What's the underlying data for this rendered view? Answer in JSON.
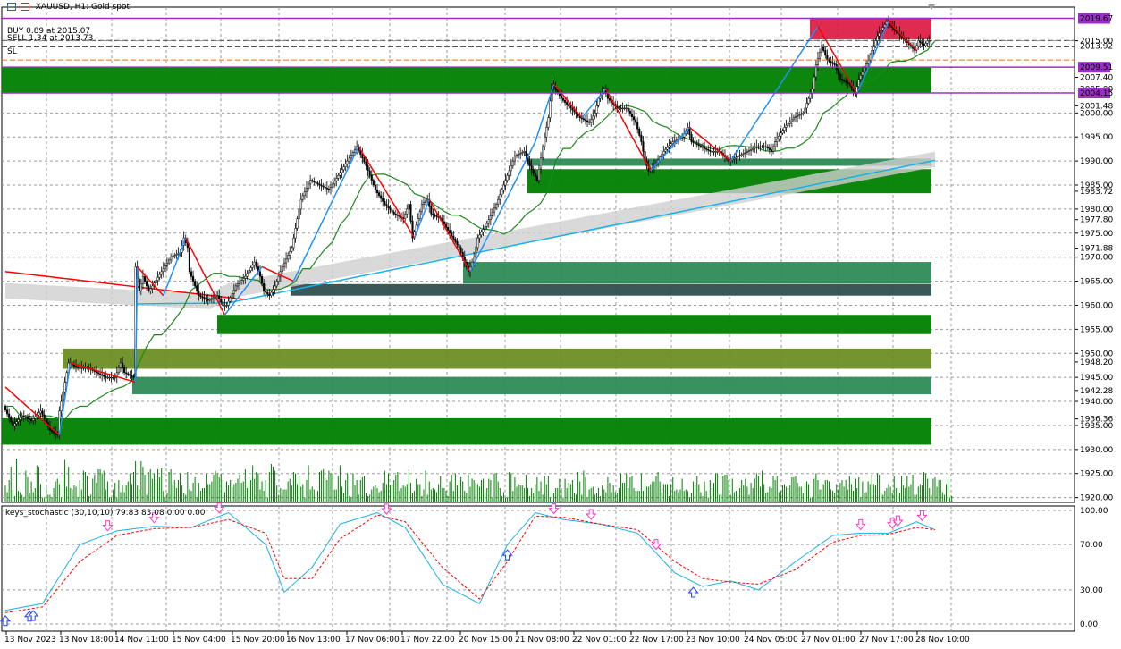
{
  "window": {
    "title": "XAUUSD, H1:  Gold spot",
    "trade_buy": "BUY 0.89 at 2015.07",
    "trade_sell": "SELL 1.34 at 2013.73",
    "trade_sl": "SL"
  },
  "indicator": {
    "label": "keys_stochastic (30,10,10) 79.83 83.08 0.00 0.00"
  },
  "colors": {
    "background": "#ffffff",
    "grid": "#9a9a9a",
    "bull_candle": "#000000",
    "level_purple": "#9b30c8",
    "zone_green": "#008000",
    "zone_olive": "#6b8e23",
    "zone_teal": "#2e8b57",
    "zone_dark": "#2f4f4f",
    "zone_red": "#dc143c",
    "ma_red": "#ff0000",
    "ma_green": "#1b8a1b",
    "ma_blue": "#1ab2e8",
    "zigzag_up": "#1e90ff",
    "zigzag_down": "#ff0000",
    "volume": "#008000",
    "stoch_main": "#1ab2e8",
    "stoch_signal": "#ff0000",
    "arrow_up": "#1e3cff",
    "arrow_down": "#ff33cc"
  },
  "chart_data": {
    "type": "candlestick",
    "symbol": "XAUUSD",
    "timeframe": "H1",
    "price_axis": {
      "ticks": [
        2019.67,
        2015.0,
        2013.92,
        2009.51,
        2007.4,
        2005.0,
        2004.15,
        2001.48,
        2000.0,
        1995.0,
        1990.0,
        1985.0,
        1983.72,
        1980.0,
        1977.8,
        1975.0,
        1971.88,
        1970.0,
        1965.0,
        1960.0,
        1955.0,
        1950.0,
        1948.2,
        1945.0,
        1942.28,
        1940.0,
        1936.36,
        1935.0,
        1930.0,
        1925.0,
        1920.0
      ],
      "range": [
        1919,
        2022
      ],
      "highlighted": [
        {
          "value": "2019.67",
          "bg": "#9b30c8"
        },
        {
          "value": "2009.51",
          "bg": "#9b30c8"
        },
        {
          "value": "2004.15",
          "bg": "#9b30c8"
        }
      ]
    },
    "time_axis": [
      "13 Nov 2023",
      "13 Nov 18:00",
      "14 Nov 11:00",
      "15 Nov 04:00",
      "15 Nov 20:00",
      "16 Nov 13:00",
      "17 Nov 06:00",
      "17 Nov 22:00",
      "20 Nov 15:00",
      "21 Nov 08:00",
      "22 Nov 01:00",
      "22 Nov 17:00",
      "23 Nov 10:00",
      "24 Nov 05:00",
      "27 Nov 01:00",
      "27 Nov 17:00",
      "28 Nov 10:00"
    ],
    "price_path": [
      [
        0,
        1939
      ],
      [
        5,
        1935
      ],
      [
        10,
        1937
      ],
      [
        15,
        1936
      ],
      [
        20,
        1938
      ],
      [
        25,
        1934
      ],
      [
        29,
        1933
      ],
      [
        30,
        1938
      ],
      [
        33,
        1944
      ],
      [
        35,
        1948
      ],
      [
        40,
        1947
      ],
      [
        45,
        1947
      ],
      [
        50,
        1946
      ],
      [
        55,
        1945
      ],
      [
        60,
        1945
      ],
      [
        63,
        1948
      ],
      [
        65,
        1946
      ],
      [
        70,
        1945
      ],
      [
        71,
        1968
      ],
      [
        73,
        1963
      ],
      [
        75,
        1966
      ],
      [
        78,
        1963
      ],
      [
        80,
        1964
      ],
      [
        85,
        1967
      ],
      [
        90,
        1970
      ],
      [
        95,
        1971
      ],
      [
        97,
        1974
      ],
      [
        99,
        1972
      ],
      [
        100,
        1967
      ],
      [
        105,
        1962
      ],
      [
        110,
        1961
      ],
      [
        115,
        1962
      ],
      [
        118,
        1960
      ],
      [
        120,
        1960
      ],
      [
        125,
        1964
      ],
      [
        130,
        1966
      ],
      [
        135,
        1969
      ],
      [
        138,
        1966
      ],
      [
        140,
        1963
      ],
      [
        143,
        1962
      ],
      [
        146,
        1964
      ],
      [
        150,
        1968
      ],
      [
        155,
        1972
      ],
      [
        160,
        1982
      ],
      [
        165,
        1986
      ],
      [
        170,
        1985
      ],
      [
        175,
        1984
      ],
      [
        180,
        1987
      ],
      [
        185,
        1990
      ],
      [
        190,
        1993
      ],
      [
        195,
        1989
      ],
      [
        200,
        1984
      ],
      [
        205,
        1981
      ],
      [
        210,
        1979
      ],
      [
        215,
        1978
      ],
      [
        218,
        1981
      ],
      [
        220,
        1974
      ],
      [
        223,
        1978
      ],
      [
        225,
        1981
      ],
      [
        228,
        1982
      ],
      [
        230,
        1979
      ],
      [
        235,
        1978
      ],
      [
        240,
        1975
      ],
      [
        245,
        1972
      ],
      [
        250,
        1967
      ],
      [
        253,
        1970
      ],
      [
        255,
        1974
      ],
      [
        260,
        1977
      ],
      [
        265,
        1981
      ],
      [
        270,
        1986
      ],
      [
        275,
        1991
      ],
      [
        280,
        1992
      ],
      [
        283,
        1989
      ],
      [
        287,
        1986
      ],
      [
        290,
        1993
      ],
      [
        293,
        1999
      ],
      [
        295,
        2006
      ],
      [
        300,
        2003
      ],
      [
        305,
        2001
      ],
      [
        310,
        1999
      ],
      [
        315,
        1998
      ],
      [
        318,
        2000
      ],
      [
        320,
        2003
      ],
      [
        323,
        2005
      ],
      [
        325,
        2003
      ],
      [
        330,
        2001
      ],
      [
        335,
        2001
      ],
      [
        340,
        1998
      ],
      [
        343,
        1994
      ],
      [
        345,
        1990
      ],
      [
        347,
        1988
      ],
      [
        350,
        1989
      ],
      [
        355,
        1992
      ],
      [
        360,
        1994
      ],
      [
        365,
        1995
      ],
      [
        368,
        1997
      ],
      [
        370,
        1994
      ],
      [
        375,
        1993
      ],
      [
        380,
        1992
      ],
      [
        385,
        1992
      ],
      [
        390,
        1990
      ],
      [
        395,
        1991
      ],
      [
        400,
        1992
      ],
      [
        405,
        1993
      ],
      [
        410,
        1993
      ],
      [
        413,
        1992
      ],
      [
        415,
        1994
      ],
      [
        420,
        1997
      ],
      [
        425,
        1999
      ],
      [
        430,
        2000
      ],
      [
        433,
        2003
      ],
      [
        435,
        2005
      ],
      [
        437,
        2010
      ],
      [
        440,
        2014
      ],
      [
        443,
        2011
      ],
      [
        447,
        2010
      ],
      [
        450,
        2007
      ],
      [
        455,
        2006
      ],
      [
        458,
        2004
      ],
      [
        460,
        2007
      ],
      [
        465,
        2011
      ],
      [
        470,
        2016
      ],
      [
        475,
        2019
      ],
      [
        480,
        2017
      ],
      [
        485,
        2015
      ],
      [
        490,
        2013
      ],
      [
        492,
        2015
      ],
      [
        495,
        2014
      ],
      [
        497,
        2015
      ]
    ],
    "volume": [
      12,
      7,
      16,
      26,
      9,
      4,
      32,
      8,
      7,
      5,
      3,
      23,
      18,
      6,
      15,
      7,
      10,
      27,
      26,
      13,
      3,
      3,
      11,
      5,
      5,
      3,
      10,
      15,
      17,
      13,
      3,
      20,
      31,
      11,
      26,
      10,
      9,
      12,
      11,
      3,
      16,
      9,
      23,
      22,
      19,
      4,
      5,
      17,
      20,
      14,
      24,
      24,
      21,
      23,
      9,
      15,
      3,
      3,
      9,
      14,
      3,
      16,
      7,
      12,
      7,
      12,
      15,
      21,
      13,
      22,
      30,
      12,
      9,
      30,
      26,
      20,
      5,
      22,
      24,
      17,
      21,
      14,
      24,
      18,
      25,
      8,
      3,
      6,
      22,
      24,
      13,
      16,
      10,
      16,
      21,
      12,
      6,
      5,
      22,
      9,
      8,
      14,
      18,
      3,
      14,
      8,
      10,
      10,
      21,
      13,
      13,
      15,
      20,
      23,
      21,
      18,
      21,
      16,
      7,
      15,
      12,
      16,
      11,
      13,
      14,
      17,
      20,
      14,
      15,
      24,
      10,
      18,
      16,
      27,
      17,
      22,
      21,
      9,
      15,
      8,
      16,
      3,
      22,
      28,
      26,
      23,
      12,
      5,
      10,
      9,
      9,
      9,
      15,
      17,
      12,
      22,
      21,
      13,
      19,
      11,
      13,
      3,
      16,
      27,
      9,
      11,
      9,
      3,
      8,
      22,
      23,
      24,
      17,
      16,
      23,
      21,
      21,
      9,
      9,
      19,
      27,
      11,
      6,
      16,
      21,
      4,
      3,
      21,
      12,
      16,
      5,
      16,
      18,
      19,
      6,
      4,
      5,
      9,
      11,
      12,
      10,
      7,
      8,
      14,
      23,
      13,
      21,
      12,
      12,
      16,
      20,
      22,
      8,
      10,
      12,
      11,
      13,
      24,
      14,
      6,
      8,
      17,
      13,
      13,
      4,
      9,
      23,
      5,
      15,
      9,
      10,
      9,
      7,
      13,
      19,
      10,
      10,
      8,
      4,
      15,
      20,
      8,
      21,
      12,
      16,
      18,
      15,
      8,
      6,
      20,
      11,
      17,
      16,
      14,
      13,
      11,
      16,
      17,
      7,
      10,
      17,
      16,
      3,
      21,
      21,
      15,
      10,
      4,
      7,
      3,
      3,
      22,
      21,
      8,
      18,
      11,
      13,
      12,
      12,
      10,
      20,
      10,
      4,
      10,
      6,
      13,
      18,
      8,
      15,
      5,
      19,
      13,
      19,
      3,
      8,
      6,
      10,
      10,
      17,
      10,
      3,
      17,
      10,
      14,
      13,
      16,
      6,
      5,
      22,
      15,
      5,
      23,
      18,
      3,
      9,
      10,
      11,
      5,
      6,
      10,
      4,
      12,
      9,
      7,
      18,
      14,
      7,
      12,
      7,
      6,
      10,
      21,
      14,
      14,
      21,
      10,
      18,
      19,
      10,
      8,
      8,
      8,
      21,
      8,
      14,
      11,
      11,
      13,
      15,
      15,
      19,
      22,
      15,
      7,
      13,
      13,
      13,
      4,
      13,
      18,
      8,
      9,
      7,
      9,
      17,
      8,
      9,
      8,
      3,
      6,
      15,
      12,
      19,
      13,
      7,
      4,
      15,
      8,
      3,
      16,
      10,
      14,
      21,
      21,
      5,
      5,
      19,
      20,
      20,
      16,
      5,
      17,
      7,
      8,
      7,
      10,
      16,
      12,
      17,
      11,
      5,
      14,
      10,
      17,
      21,
      19,
      11,
      23,
      13,
      6,
      7,
      11,
      10,
      19,
      16,
      19,
      7,
      8,
      12,
      13,
      11,
      10,
      12,
      18,
      18,
      19,
      14,
      11,
      11,
      6,
      14,
      15,
      13,
      3,
      3,
      17,
      21,
      16,
      9,
      9,
      13,
      16,
      16,
      15,
      9,
      8,
      6,
      13,
      9,
      14,
      16,
      11,
      16,
      9,
      19,
      13,
      8,
      17,
      10,
      18,
      3,
      15,
      6,
      7,
      15,
      13,
      20,
      13,
      12,
      21,
      20,
      6,
      5,
      8,
      10,
      13,
      11,
      6,
      19,
      10,
      10,
      6,
      19,
      12,
      10,
      19,
      11,
      13,
      20,
      5,
      5,
      11,
      13,
      12,
      22,
      21,
      17,
      10,
      5,
      17,
      18,
      11,
      16,
      16,
      7,
      5,
      13,
      18,
      3,
      4
    ],
    "stochastic": {
      "range": [
        0,
        100
      ],
      "ticks": [
        "100.00",
        "70.00",
        "30.00",
        "0.00"
      ],
      "main": [
        [
          0,
          12
        ],
        [
          20,
          18
        ],
        [
          40,
          70
        ],
        [
          60,
          82
        ],
        [
          80,
          86
        ],
        [
          100,
          85
        ],
        [
          120,
          98
        ],
        [
          140,
          70
        ],
        [
          150,
          28
        ],
        [
          165,
          50
        ],
        [
          180,
          88
        ],
        [
          200,
          98
        ],
        [
          215,
          85
        ],
        [
          235,
          35
        ],
        [
          255,
          18
        ],
        [
          270,
          70
        ],
        [
          285,
          98
        ],
        [
          300,
          92
        ],
        [
          320,
          88
        ],
        [
          340,
          80
        ],
        [
          360,
          45
        ],
        [
          375,
          33
        ],
        [
          390,
          38
        ],
        [
          405,
          30
        ],
        [
          425,
          55
        ],
        [
          445,
          78
        ],
        [
          460,
          80
        ],
        [
          475,
          80
        ],
        [
          490,
          90
        ],
        [
          500,
          83
        ]
      ],
      "signal": [
        [
          0,
          10
        ],
        [
          20,
          15
        ],
        [
          40,
          55
        ],
        [
          60,
          78
        ],
        [
          80,
          84
        ],
        [
          100,
          85
        ],
        [
          120,
          92
        ],
        [
          140,
          80
        ],
        [
          150,
          40
        ],
        [
          165,
          40
        ],
        [
          180,
          75
        ],
        [
          200,
          96
        ],
        [
          215,
          90
        ],
        [
          235,
          50
        ],
        [
          255,
          22
        ],
        [
          270,
          55
        ],
        [
          285,
          95
        ],
        [
          300,
          94
        ],
        [
          320,
          88
        ],
        [
          340,
          83
        ],
        [
          360,
          55
        ],
        [
          375,
          40
        ],
        [
          390,
          37
        ],
        [
          405,
          35
        ],
        [
          425,
          48
        ],
        [
          445,
          72
        ],
        [
          460,
          78
        ],
        [
          475,
          79
        ],
        [
          490,
          85
        ],
        [
          500,
          83
        ]
      ],
      "arrows_up": [
        0,
        13,
        15,
        270,
        370
      ],
      "arrows_down": [
        55,
        80,
        115,
        205,
        295,
        315,
        350,
        460,
        477,
        480,
        493
      ]
    }
  }
}
